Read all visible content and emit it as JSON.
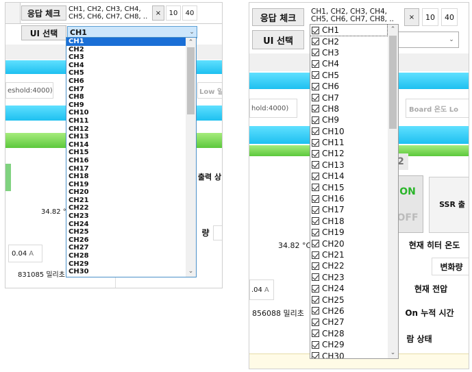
{
  "left": {
    "response_check_label": "응답 체크",
    "channels_text": "CH1, CH2, CH3, CH4,\nCH5, CH6, CH7, CH8, ..",
    "x_label": "×",
    "val_10": "10",
    "val_40": "40",
    "ui_select_label": "UI 선택",
    "select_value": "CH1",
    "threshold_text": "eshold:4000)",
    "low_text": "Low 일",
    "output_text": "출력 상",
    "temp_value": "34.82 °C",
    "rate_text": "량",
    "current_value": "0.04",
    "current_unit": "A",
    "time_value": "831085 밀리초",
    "dropdown_items": [
      "CH1",
      "CH2",
      "CH3",
      "CH4",
      "CH5",
      "CH6",
      "CH7",
      "CH8",
      "CH9",
      "CH10",
      "CH11",
      "CH12",
      "CH13",
      "CH14",
      "CH15",
      "CH16",
      "CH17",
      "CH18",
      "CH19",
      "CH20",
      "CH21",
      "CH22",
      "CH23",
      "CH24",
      "CH25",
      "CH26",
      "CH27",
      "CH28",
      "CH29",
      "CH30"
    ]
  },
  "right": {
    "response_check_label": "응답 체크",
    "channels_text": "CH1, CH2, CH3, CH4,\nCH5, CH6, CH7, CH8, ..",
    "x_label": "×",
    "val_10": "10",
    "val_40": "40",
    "ui_select_label": "UI 선택",
    "threshold_text": "hold:4000)",
    "board_temp_text": "Board 온도 Lo",
    "num_2": "2",
    "on_label": "ON",
    "off_label": "OFF",
    "ssr_label": "SSR 출",
    "temp_value": "34.82 °C",
    "heater_temp_label": "현재 히터 온도",
    "change_label": "변화량",
    "current_value": ".04",
    "current_unit": "A",
    "voltage_label": "현재 전압",
    "time_value": "856088 밀리초",
    "on_time_label": "On 누적 시간",
    "alarm_label": "람 상태",
    "check_items": [
      "CH1",
      "CH2",
      "CH3",
      "CH4",
      "CH5",
      "CH6",
      "CH7",
      "CH8",
      "CH9",
      "CH10",
      "CH11",
      "CH12",
      "CH13",
      "CH14",
      "CH15",
      "CH16",
      "CH17",
      "CH18",
      "CH19",
      "CH20",
      "CH21",
      "CH22",
      "CH23",
      "CH24",
      "CH25",
      "CH26",
      "CH27",
      "CH28",
      "CH29",
      "CH30"
    ]
  },
  "colors": {
    "accent": "#1a6fd6",
    "cyan_bar": "#1ec0f0",
    "green_bar": "#5cc83c"
  }
}
